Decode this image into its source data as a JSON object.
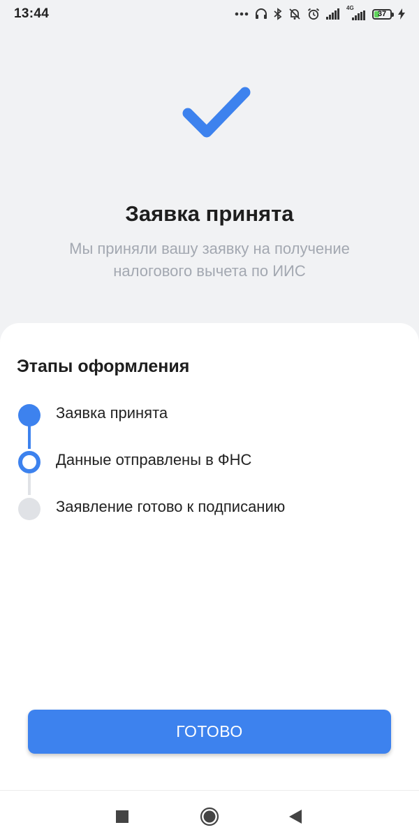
{
  "status_bar": {
    "time": "13:44",
    "icons": [
      "more-dots-icon",
      "headphones-icon",
      "bluetooth-icon",
      "bell-muted-icon",
      "alarm-icon",
      "signal-icon",
      "signal-4g-icon",
      "battery-icon",
      "charging-icon"
    ],
    "network_label": "4G",
    "battery_level": "37",
    "battery_fraction": 0.37
  },
  "hero": {
    "icon": "checkmark-icon",
    "title": "Заявка принята",
    "subtitle": "Мы приняли вашу заявку на получение налогового вычета по ИИС"
  },
  "stages": {
    "title": "Этапы оформления",
    "steps": [
      {
        "label": "Заявка принята",
        "state": "done"
      },
      {
        "label": "Данные отправлены в ФНС",
        "state": "active"
      },
      {
        "label": "Заявление готово к подписанию",
        "state": "pending"
      }
    ]
  },
  "actions": {
    "done_label": "ГОТОВО"
  },
  "nav_bar": {
    "icons": [
      "recents-square-icon",
      "home-circle-icon",
      "back-triangle-icon"
    ]
  },
  "colors": {
    "accent": "#3d82ee",
    "background": "#f1f2f4",
    "subtitle": "#a3a8b1",
    "pending": "#e0e2e6"
  }
}
